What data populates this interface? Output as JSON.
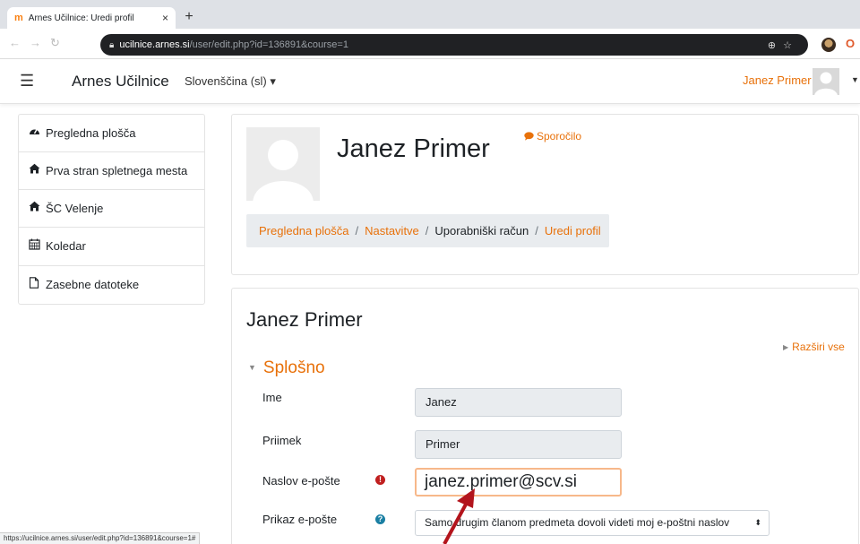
{
  "browser": {
    "tab_title": "Arnes Učilnice: Uredi profil",
    "tab_close": "×",
    "new_tab": "+",
    "url_host": "ucilnice.arnes.si",
    "url_path": "/user/edit.php?id=136891&course=1",
    "status_url": "https://ucilnice.arnes.si/user/edit.php?id=136891&course=1#"
  },
  "navbar": {
    "brand": "Arnes Učilnice",
    "language": "Slovenščina (sl) ▾",
    "user_name": "Janez Primer"
  },
  "drawer": {
    "items": [
      {
        "label": "Pregledna plošča",
        "icon": "dashboard-icon"
      },
      {
        "label": "Prva stran spletnega mesta",
        "icon": "home-icon"
      },
      {
        "label": "ŠC Velenje",
        "icon": "home-icon"
      },
      {
        "label": "Koledar",
        "icon": "calendar-icon"
      },
      {
        "label": "Zasebne datoteke",
        "icon": "file-icon"
      }
    ]
  },
  "header": {
    "name": "Janez Primer",
    "message_link": "Sporočilo",
    "breadcrumb": {
      "item1": "Pregledna plošča",
      "item2": "Nastavitve",
      "item3": "Uporabniški račun",
      "item4": "Uredi profil"
    }
  },
  "form": {
    "title": "Janez Primer",
    "expand_all": "Razširi vse",
    "section": "Splošno",
    "first_name_label": "Ime",
    "first_name_value": "Janez",
    "last_name_label": "Priimek",
    "last_name_value": "Primer",
    "email_label": "Naslov e-pošte",
    "email_value": "janez.primer@scv.si",
    "email_display_label": "Prikaz e-pošte",
    "email_display_value": "Samo drugim članom predmeta dovoli videti moj e-poštni naslov"
  },
  "colors": {
    "accent": "#e8710a",
    "required": "#c01f1f",
    "help": "#1a7fa3",
    "annotation_arrow": "#b3141c"
  }
}
